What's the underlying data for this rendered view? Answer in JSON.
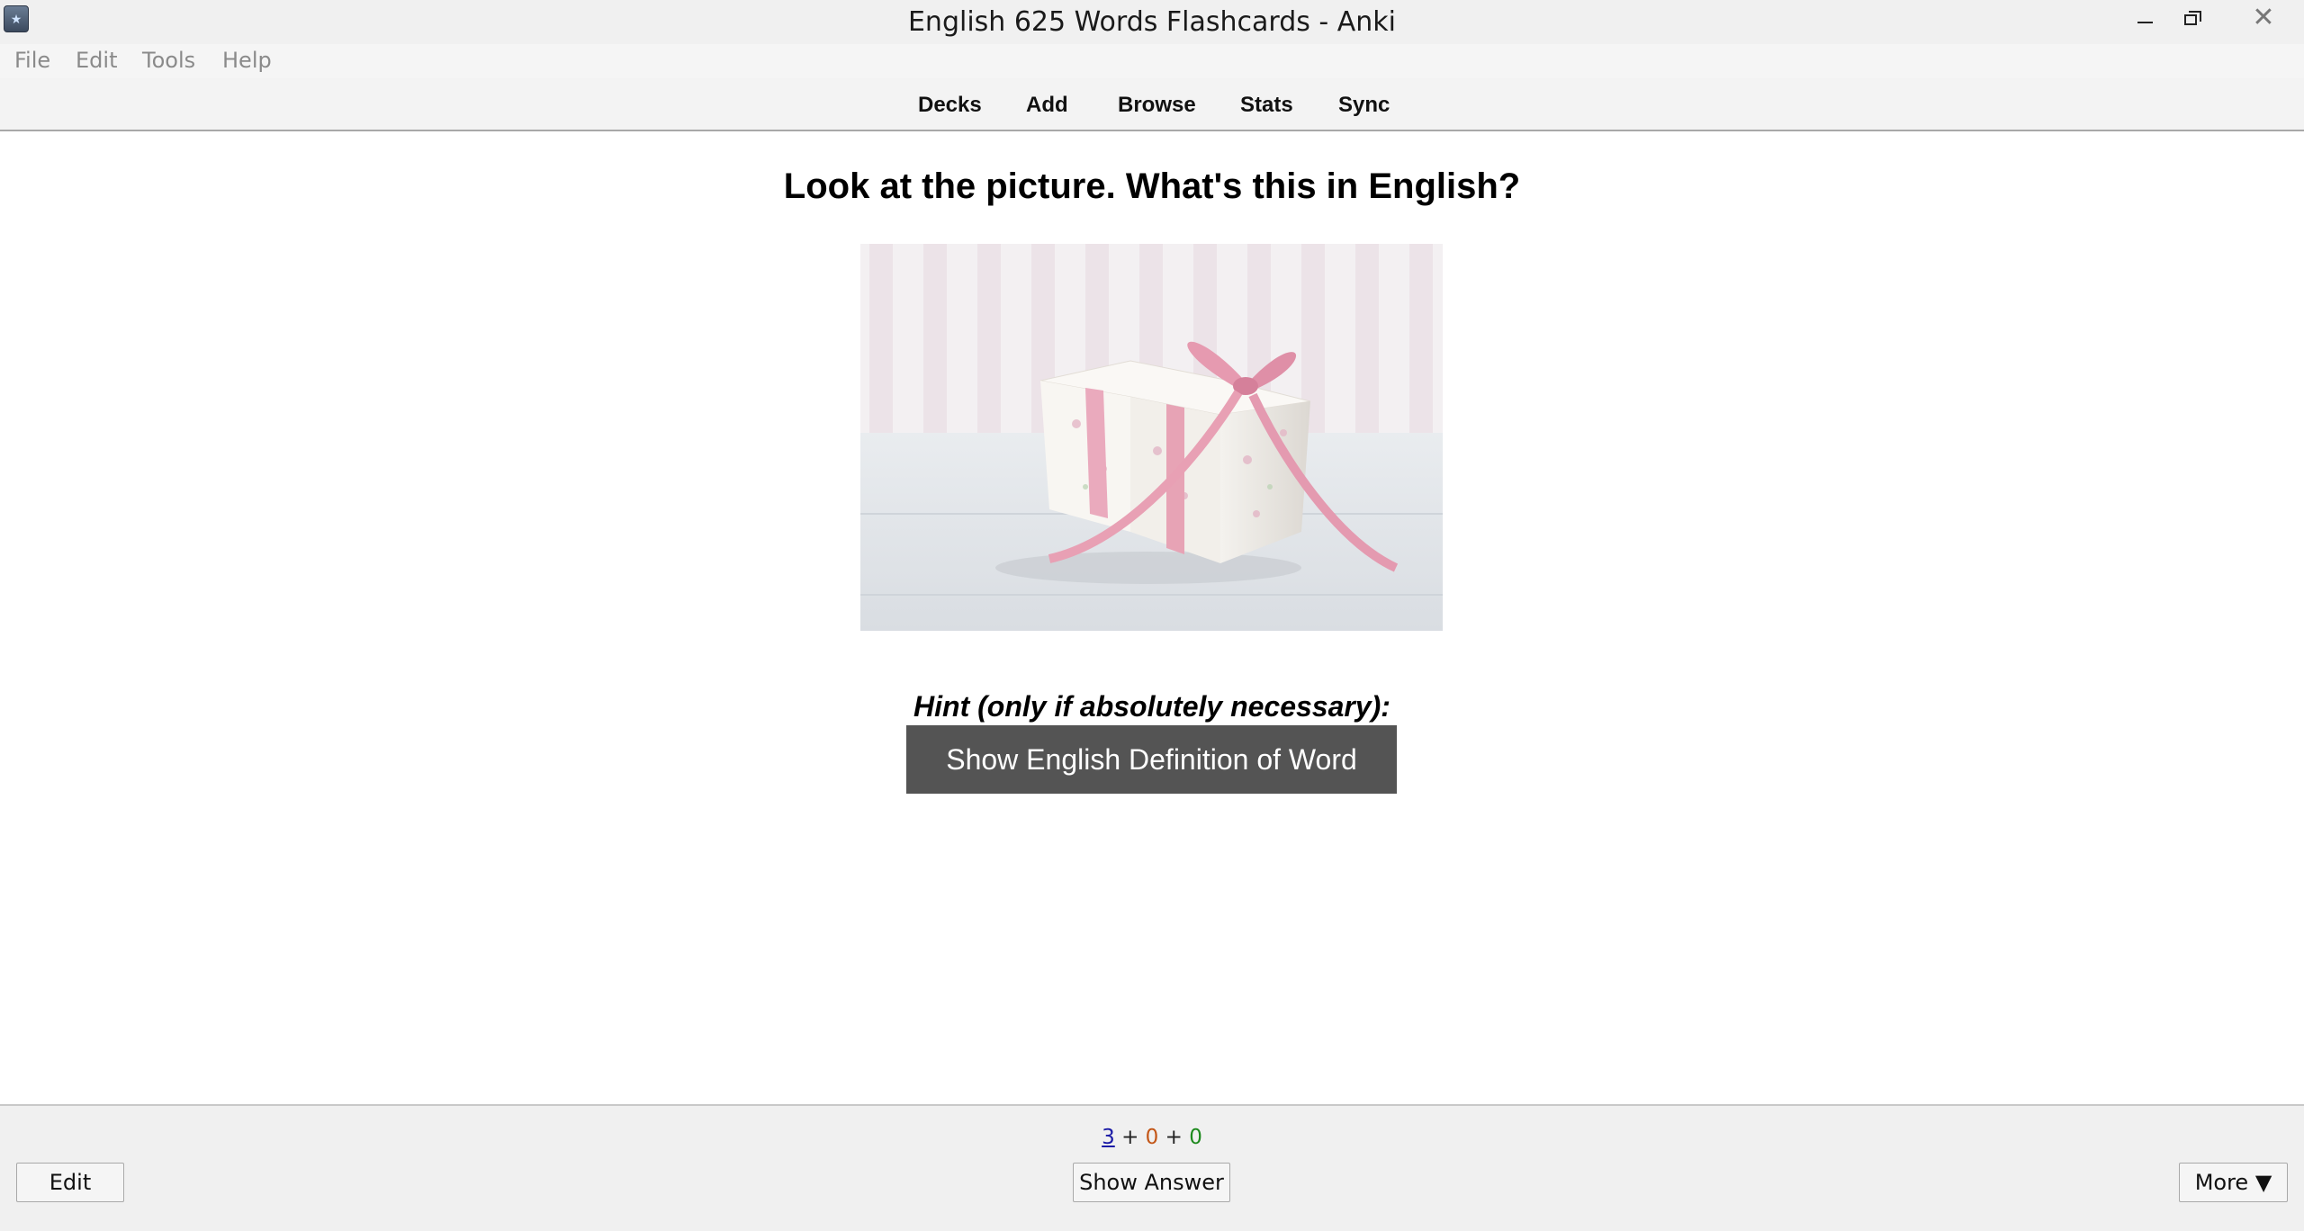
{
  "window": {
    "title": "English 625 Words Flashcards - Anki"
  },
  "menu": {
    "items": [
      "File",
      "Edit",
      "Tools",
      "Help"
    ]
  },
  "toolbar": {
    "links": [
      "Decks",
      "Add",
      "Browse",
      "Stats",
      "Sync"
    ]
  },
  "card": {
    "question": "Look at the picture. What's this in English?",
    "picture_subject": "gift-box-with-pink-ribbon",
    "hint_label": "Hint (only if absolutely necessary):",
    "hint_button": "Show English Definition of Word"
  },
  "bottom": {
    "counts": {
      "new": "3",
      "learning": "0",
      "review": "0",
      "separator": "+"
    },
    "edit_label": "Edit",
    "show_answer_label": "Show Answer",
    "more_label": "More ▼"
  },
  "colors": {
    "hint_button_bg": "#545454",
    "count_new": "#1a1aa6",
    "count_learning": "#c35617",
    "count_review": "#1e8a1e"
  }
}
